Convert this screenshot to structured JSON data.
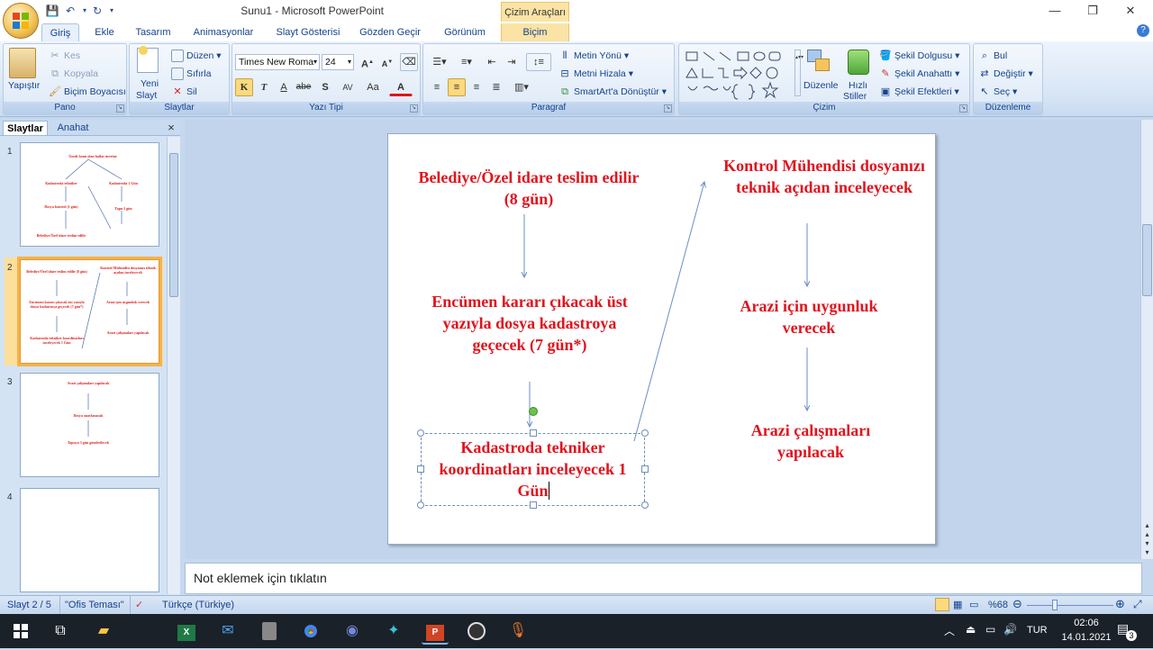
{
  "window": {
    "title": "Sunu1 - Microsoft PowerPoint",
    "context_tab_title": "Çizim Araçları",
    "controls": {
      "minimize": "—",
      "restore": "❐",
      "close": "✕"
    }
  },
  "tabs": [
    "Giriş",
    "Ekle",
    "Tasarım",
    "Animasyonlar",
    "Slayt Gösterisi",
    "Gözden Geçir",
    "Görünüm",
    "Biçim"
  ],
  "ribbon": {
    "pano": {
      "label": "Pano",
      "paste": "Yapıştır",
      "cut": "Kes",
      "copy": "Kopyala",
      "format_painter": "Biçim Boyacısı"
    },
    "slaytlar": {
      "label": "Slaytlar",
      "new_slide": "Yeni",
      "new_slide_2": "Slayt",
      "layout": "Düzen",
      "reset": "Sıfırla",
      "delete": "Sil"
    },
    "yazi_tipi": {
      "label": "Yazı Tipi",
      "font_name": "Times New Roma",
      "font_size": "24",
      "bold": "K",
      "italic": "T",
      "underline": "A",
      "strike": "abe",
      "shadow": "S",
      "spacing": "AV",
      "case": "Aa",
      "color": "A"
    },
    "paragraf": {
      "label": "Paragraf",
      "text_direction": "Metin Yönü",
      "align_text": "Metni Hizala",
      "smartart": "SmartArt'a Dönüştür"
    },
    "cizim": {
      "label": "Çizim",
      "arrange": "Düzenle",
      "quick_styles": "Hızlı",
      "quick_styles_2": "Stiller",
      "shape_fill": "Şekil Dolgusu",
      "shape_outline": "Şekil Anahattı",
      "shape_effects": "Şekil Efektleri"
    },
    "duzenleme": {
      "label": "Düzenleme",
      "find": "Bul",
      "replace": "Değiştir",
      "select": "Seç"
    }
  },
  "slides_pane": {
    "tab_slides": "Slaytlar",
    "tab_outline": "Anahat",
    "close": "×",
    "numbers": [
      "1",
      "2",
      "3",
      "4"
    ]
  },
  "slide": {
    "left_col": [
      "Belediye/Özel idare teslim edilir (8 gün)",
      "Encümen kararı çıkacak üst yazıyla dosya kadastroya geçecek (7 gün*)",
      "Kadastroda tekniker koordinatları inceleyecek 1 Gün"
    ],
    "right_col": [
      "Kontrol Mühendisi dosyanızı teknik açıdan inceleyecek",
      "Arazi için uygunluk verecek",
      "Arazi çalışmaları yapılacak"
    ]
  },
  "thumbnails": {
    "s1": [
      "Ümde konu olan hatlar üzerine",
      "Kadastroda tekniker",
      "Kadastroda 1 Gün",
      "Dosya kontrol (1 gün)",
      "Tapu 2 gün",
      "Belediye/Özel idare teslim edilir"
    ],
    "s3": [
      "Arazi çalışmaları yapılacak",
      "Dosya onaylanacak",
      "Tapuya 3 gün gönderilecek"
    ]
  },
  "notes": {
    "placeholder": "Not eklemek için tıklatın"
  },
  "status": {
    "slide_info": "Slayt 2 / 5",
    "theme": "\"Ofis Teması\"",
    "language": "Türkçe (Türkiye)",
    "zoom": "%68"
  },
  "taskbar": {
    "lang": "TUR",
    "time": "02:06",
    "date": "14.01.2021",
    "notif_count": "3"
  },
  "colors": {
    "slide_text": "#e0141e",
    "ribbon_text": "#15428b",
    "selected_thumb": "#f6b24a"
  }
}
